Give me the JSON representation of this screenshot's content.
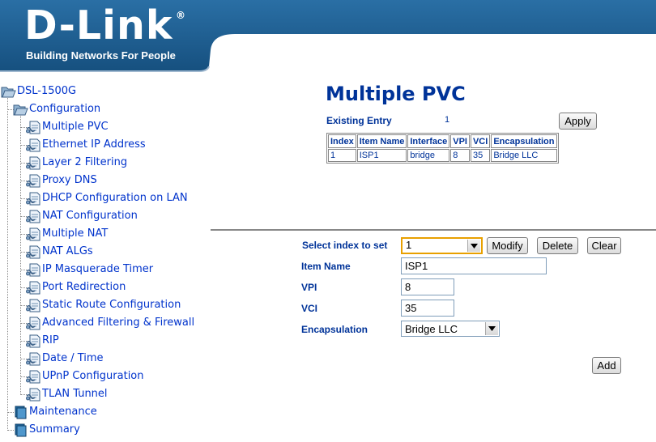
{
  "brand": {
    "logo": "D-Link",
    "registered": "®",
    "tagline": "Building Networks For People"
  },
  "tree": {
    "root": "DSL-1500G",
    "configuration": "Configuration",
    "items": [
      "Multiple PVC",
      "Ethernet IP Address",
      "Layer 2 Filtering",
      "Proxy DNS",
      "DHCP Configuration on LAN",
      "NAT Configuration",
      "Multiple NAT",
      "NAT ALGs",
      "IP Masquerade Timer",
      "Port Redirection",
      "Static Route Configuration",
      "Advanced Filtering & Firewall",
      "RIP",
      "Date / Time",
      "UPnP Configuration",
      "TLAN Tunnel"
    ],
    "maintenance": "Maintenance",
    "summary": "Summary"
  },
  "page": {
    "title": "Multiple PVC",
    "existing_entry_label": "Existing Entry",
    "existing_entry_count": "1",
    "apply_label": "Apply"
  },
  "table": {
    "headers": [
      "Index",
      "Item Name",
      "Interface",
      "VPI",
      "VCI",
      "Encapsulation"
    ],
    "rows": [
      [
        "1",
        "ISP1",
        "bridge",
        "8",
        "35",
        "Bridge LLC"
      ]
    ]
  },
  "form": {
    "select_index_label": "Select index to set",
    "select_index_value": "1",
    "modify_label": "Modify",
    "delete_label": "Delete",
    "clear_label": "Clear",
    "item_name_label": "Item Name",
    "item_name_value": "ISP1",
    "vpi_label": "VPI",
    "vpi_value": "8",
    "vci_label": "VCI",
    "vci_value": "35",
    "encap_label": "Encapsulation",
    "encap_value": "Bridge LLC",
    "add_label": "Add"
  },
  "colors": {
    "header_blue": "#1d5f92",
    "link_blue": "#0033cc",
    "label_blue": "#003399"
  }
}
